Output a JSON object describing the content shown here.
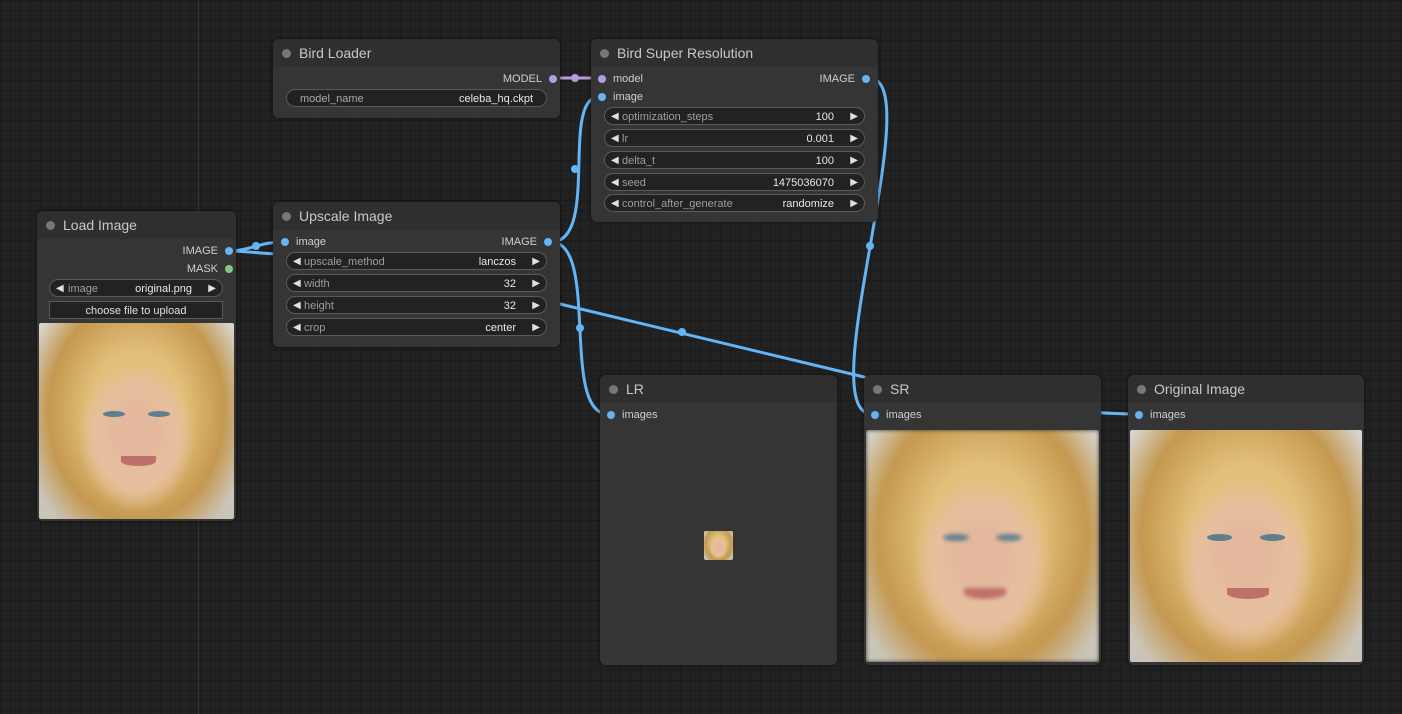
{
  "nodes": {
    "load_image": {
      "title": "Load Image",
      "outputs": [
        "IMAGE",
        "MASK"
      ],
      "widget_image": {
        "label": "image",
        "value": "original.png"
      },
      "upload_label": "choose file to upload"
    },
    "bird_loader": {
      "title": "Bird Loader",
      "output": "MODEL",
      "widget_model": {
        "label": "model_name",
        "value": "celeba_hq.ckpt"
      }
    },
    "upscale_image": {
      "title": "Upscale Image",
      "input": "image",
      "output": "IMAGE",
      "widgets": [
        {
          "label": "upscale_method",
          "value": "lanczos"
        },
        {
          "label": "width",
          "value": "32"
        },
        {
          "label": "height",
          "value": "32"
        },
        {
          "label": "crop",
          "value": "center"
        }
      ]
    },
    "bird_sr": {
      "title": "Bird Super Resolution",
      "inputs": [
        "model",
        "image"
      ],
      "output": "IMAGE",
      "widgets": [
        {
          "label": "optimization_steps",
          "value": "100"
        },
        {
          "label": "lr",
          "value": "0.001"
        },
        {
          "label": "delta_t",
          "value": "100"
        },
        {
          "label": "seed",
          "value": "1475036070"
        },
        {
          "label": "control_after_generate",
          "value": "randomize"
        }
      ]
    },
    "lr": {
      "title": "LR",
      "input": "images"
    },
    "sr": {
      "title": "SR",
      "input": "images"
    },
    "original": {
      "title": "Original Image",
      "input": "images"
    }
  },
  "colors": {
    "image_link": "#64b5f6",
    "model_link": "#b39ddb",
    "mask_slot": "#81c784",
    "node_bg": "#353535",
    "canvas_bg": "#222222"
  }
}
